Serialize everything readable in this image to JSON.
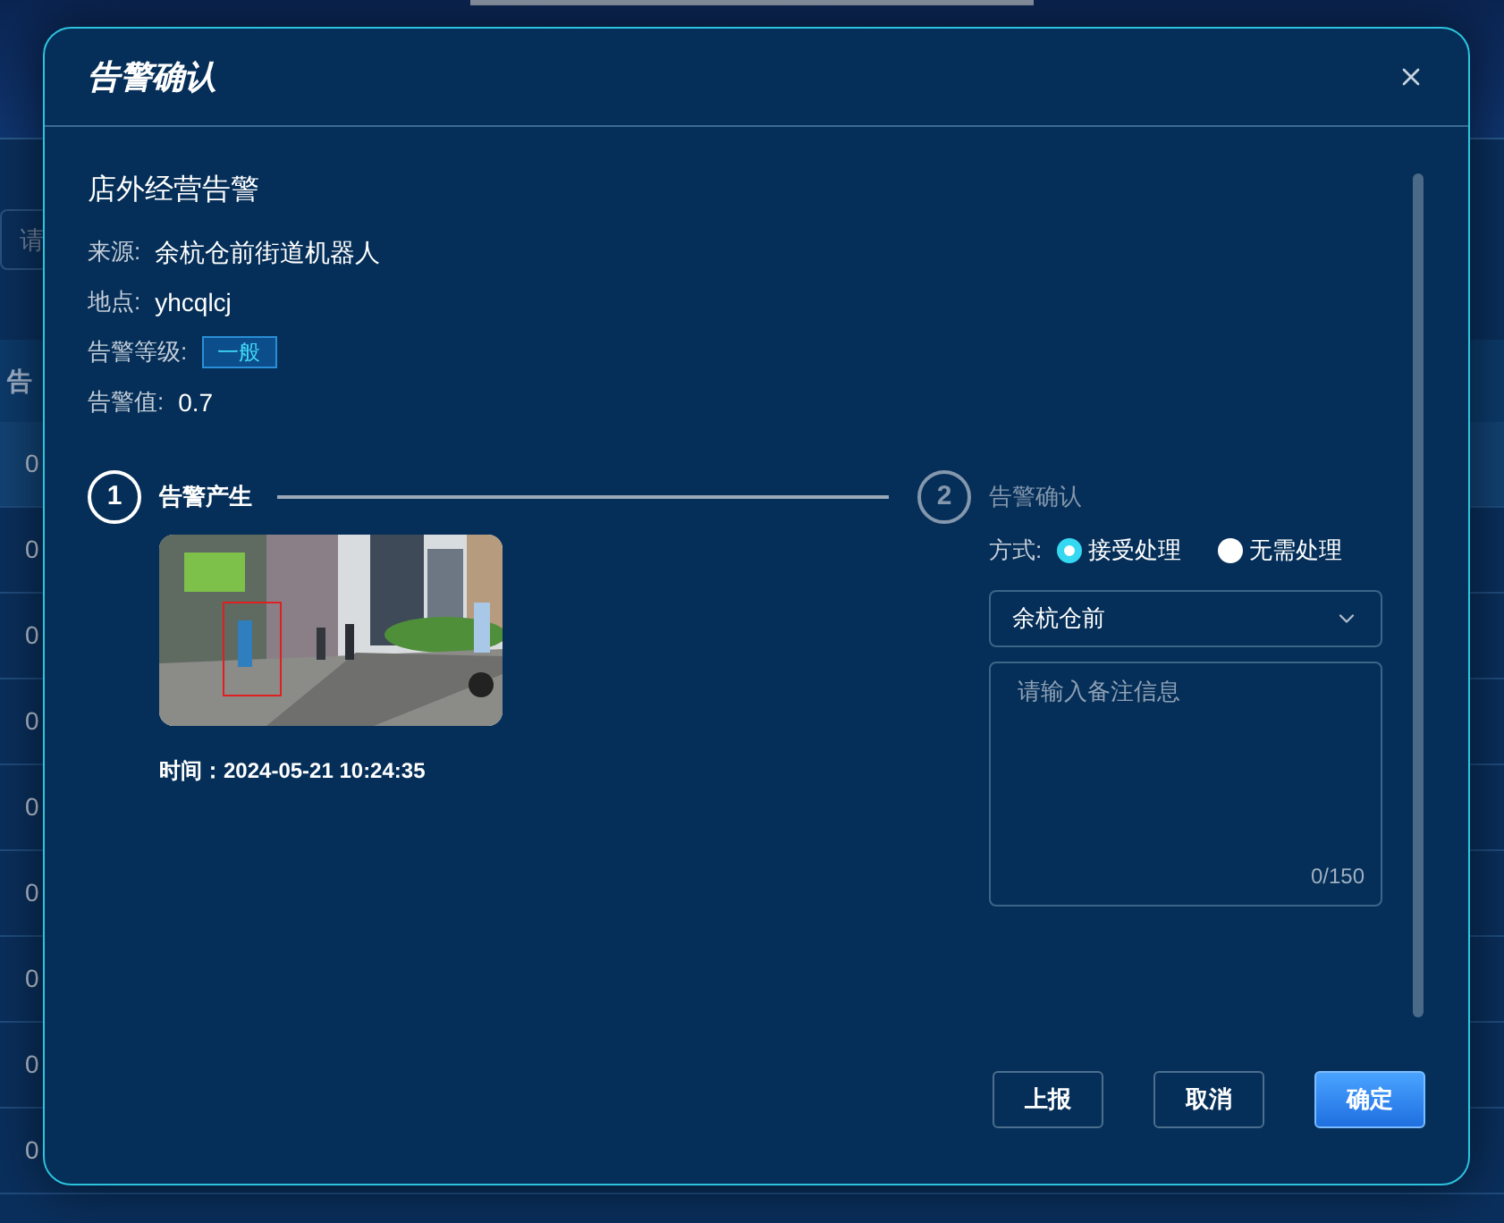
{
  "background": {
    "filter_fragment": "请",
    "header_fragment": "告",
    "row_fragments": [
      "0",
      "0",
      "0",
      "0",
      "0",
      "0",
      "0",
      "0",
      "0"
    ]
  },
  "dialog": {
    "title": "告警确认"
  },
  "alert": {
    "name": "店外经营告警",
    "fields": [
      {
        "label": "来源:",
        "value": "余杭仓前街道机器人",
        "kind": "text"
      },
      {
        "label": "地点:",
        "value": "yhcqlcj",
        "kind": "text"
      },
      {
        "label": "告警等级:",
        "value": "一般",
        "kind": "badge"
      },
      {
        "label": "告警值:",
        "value": "0.7",
        "kind": "text"
      }
    ]
  },
  "steps": [
    {
      "number": "1",
      "title": "告警产生",
      "selected": true
    },
    {
      "number": "2",
      "title": "告警确认",
      "selected": false
    }
  ],
  "capture": {
    "time": "时间：2024-05-21 10:24:35"
  },
  "confirm": {
    "method_label": "方式:",
    "options": [
      {
        "label": "接受处理",
        "selected": true
      },
      {
        "label": "无需处理",
        "selected": false
      }
    ],
    "location": {
      "value": "余杭仓前"
    },
    "remark": {
      "placeholder": "请输入备注信息",
      "count": "0/150"
    }
  },
  "buttons": [
    {
      "label": "上报",
      "kind": "secondary"
    },
    {
      "label": "取消",
      "kind": "secondary"
    },
    {
      "label": "确定",
      "kind": "primary"
    }
  ]
}
